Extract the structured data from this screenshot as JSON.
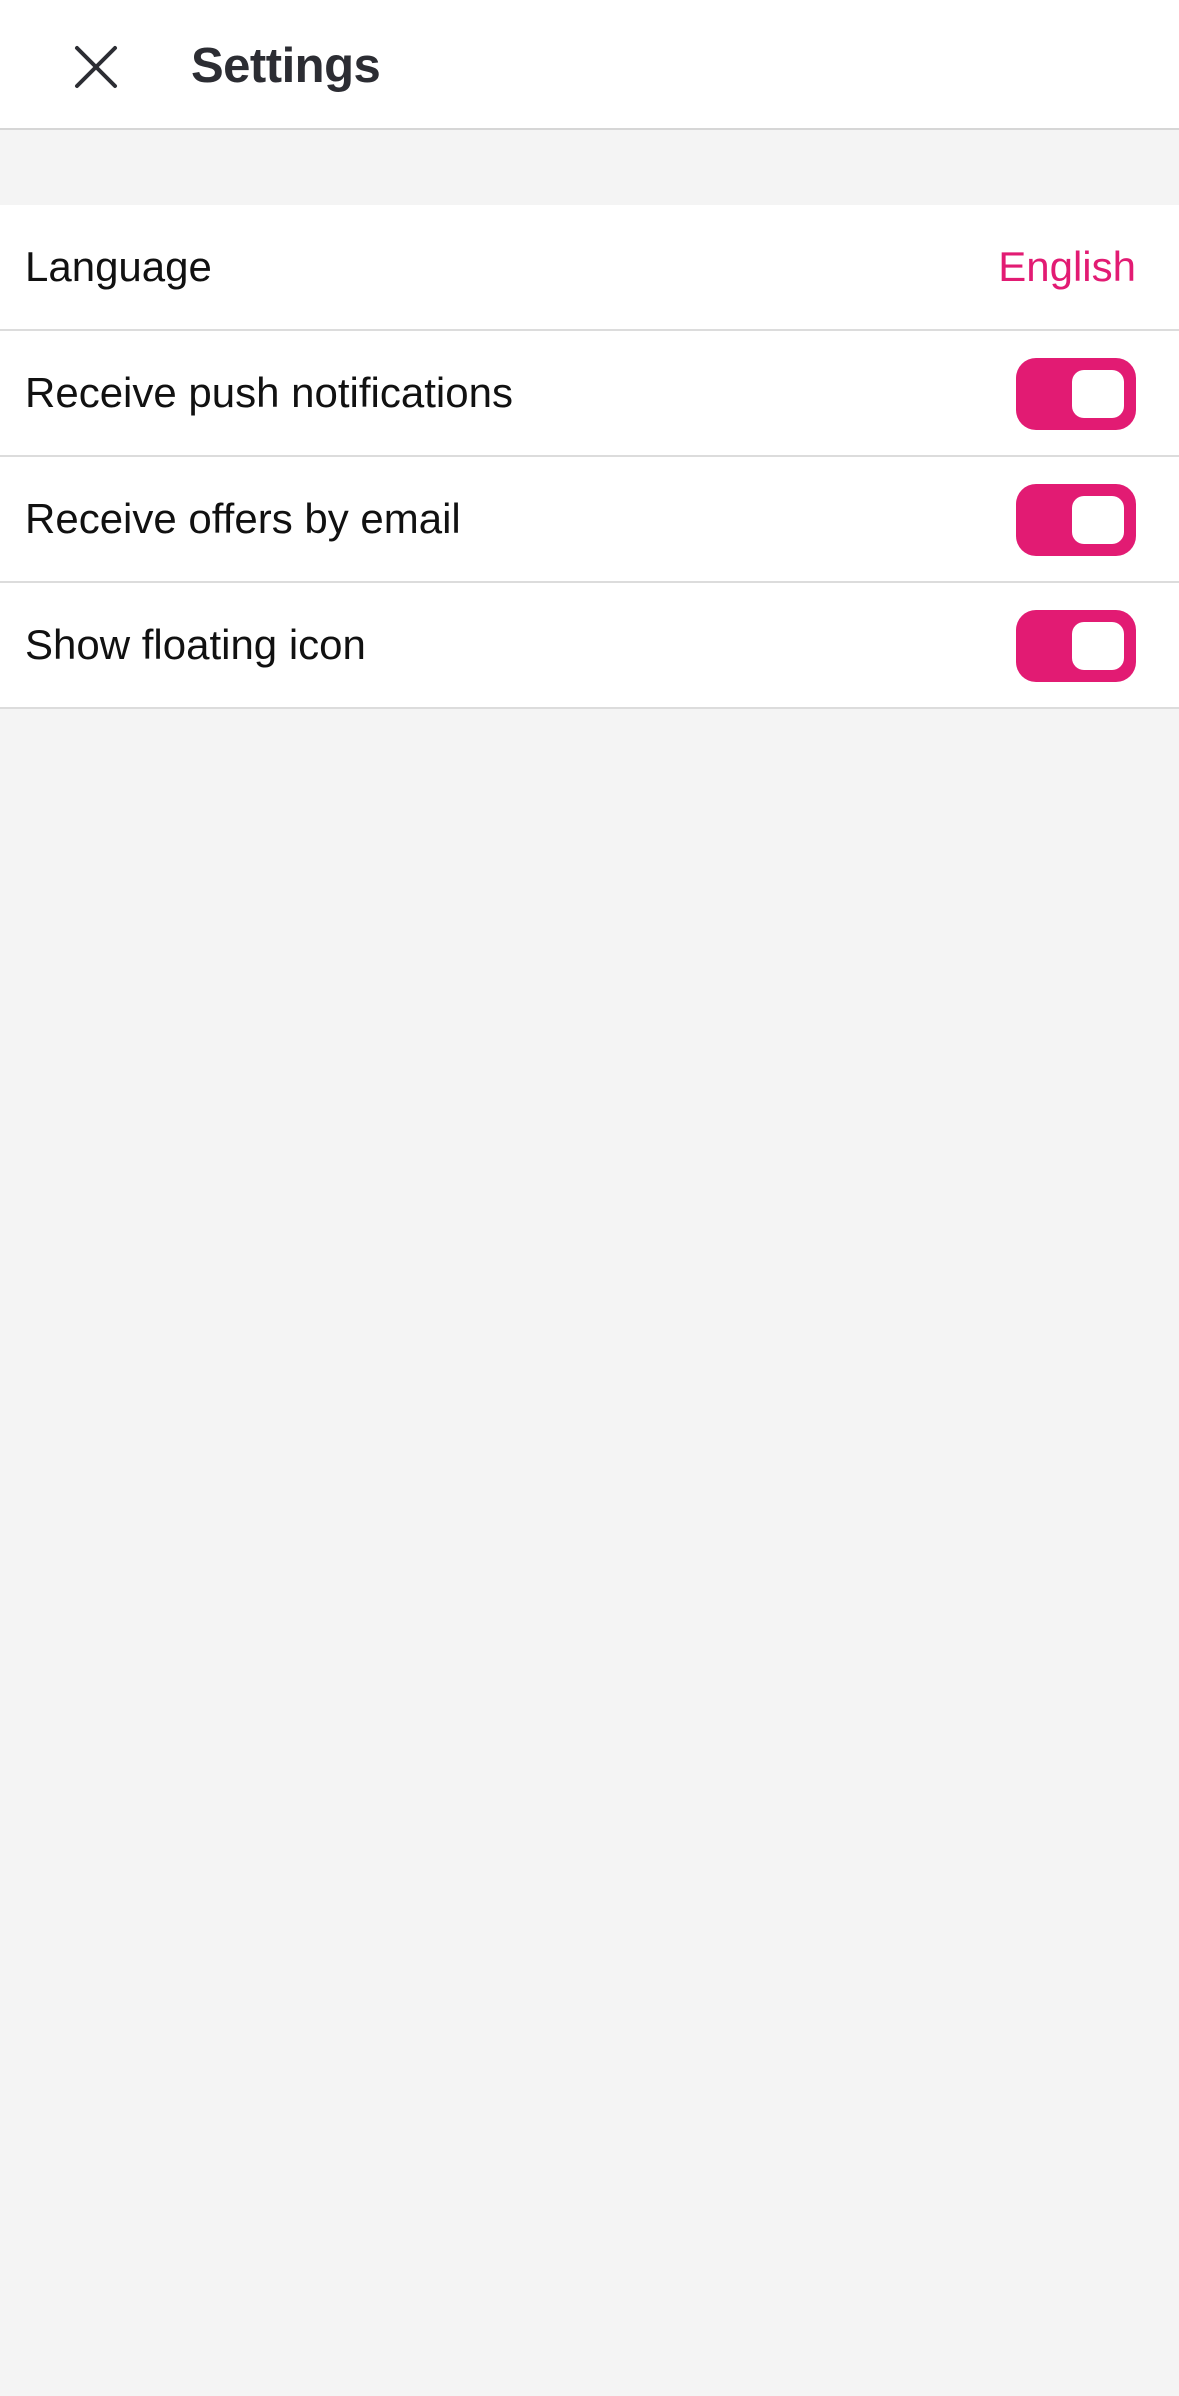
{
  "header": {
    "title": "Settings",
    "close_icon": "close-icon"
  },
  "colors": {
    "accent": "#e21b73",
    "title": "#2c2d33",
    "background": "#f4f4f4",
    "divider": "#dcdcdc"
  },
  "settings": {
    "language": {
      "label": "Language",
      "value": "English"
    },
    "push_notifications": {
      "label": "Receive push notifications",
      "enabled": true
    },
    "offers_email": {
      "label": "Receive offers by email",
      "enabled": true
    },
    "floating_icon": {
      "label": "Show floating icon",
      "enabled": true
    }
  }
}
